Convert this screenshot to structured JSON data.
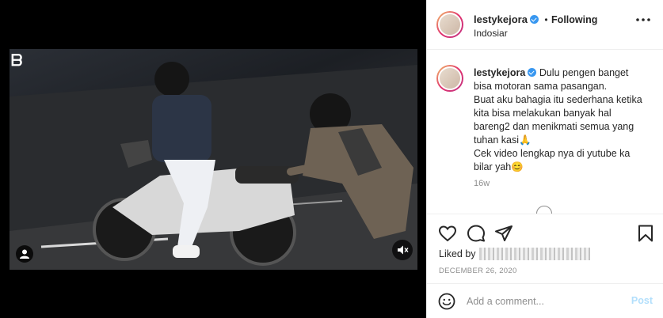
{
  "post": {
    "username": "lestykejora",
    "follow_separator": "•",
    "follow_label": "Following",
    "location": "Indosiar"
  },
  "caption": {
    "username": "lestykejora",
    "lines": [
      "Dulu pengen banget",
      "bisa motoran sama pasangan.",
      "Buat aku bahagia itu sederhana ketika",
      "kita bisa melakukan banyak hal",
      "bareng2 dan menikmati semua yang",
      "tuhan kasi🙏",
      "Cek video lengkap nya di yutube ka",
      "bilar yah😊"
    ],
    "time": "16w"
  },
  "actions": {
    "liked_by": "Liked by",
    "date": "DECEMBER 26, 2020"
  },
  "comment": {
    "placeholder": "Add a comment...",
    "post_label": "Post"
  },
  "colors": {
    "accent": "#3897f0",
    "post_disabled": "#b2dffc",
    "muted": "#8e8e8e"
  },
  "icons": [
    "heart-icon",
    "comment-icon",
    "share-icon",
    "bookmark-icon",
    "emoji-icon",
    "more-icon",
    "verified-icon",
    "mute-icon",
    "tag-icon",
    "load-more-icon"
  ]
}
